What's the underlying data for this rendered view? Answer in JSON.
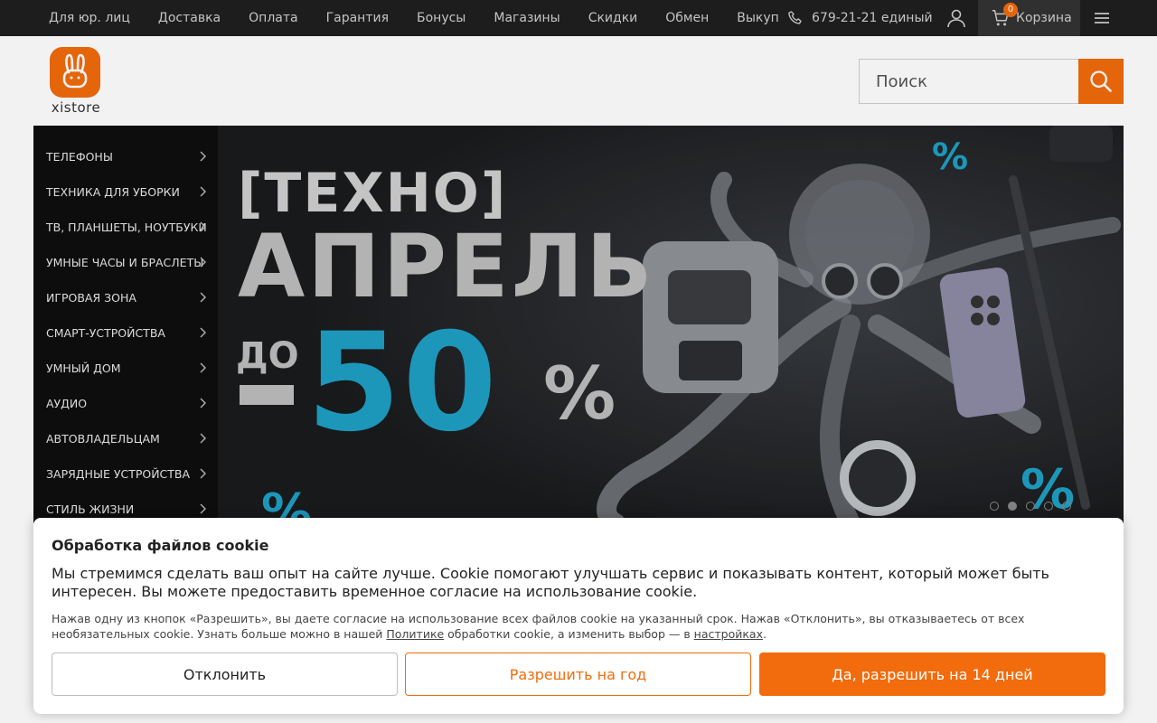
{
  "topbar": {
    "nav": [
      "Для юр. лиц",
      "Доставка",
      "Оплата",
      "Гарантия",
      "Бонусы",
      "Магазины",
      "Скидки",
      "Обмен",
      "Выкуп"
    ],
    "phone": "679-21-21 единый",
    "cart_label": "Корзина",
    "cart_count": "0"
  },
  "header": {
    "logo_text": "xistore",
    "search_placeholder": "Поиск"
  },
  "categories": [
    "ТЕЛЕФОНЫ",
    "ТЕХНИКА ДЛЯ УБОРКИ",
    "ТВ, ПЛАНШЕТЫ, НОУТБУКИ",
    "УМНЫЕ ЧАСЫ И БРАСЛЕТЫ",
    "ИГРОВАЯ ЗОНА",
    "СМАРТ-УСТРОЙСТВА",
    "УМНЫЙ ДОМ",
    "АУДИО",
    "АВТОВЛАДЕЛЬЦАМ",
    "ЗАРЯДНЫЕ УСТРОЙСТВА",
    "СТИЛЬ ЖИЗНИ"
  ],
  "banner": {
    "title": "[ТЕХНО]",
    "word": "АПРЕЛЬ",
    "do": "ДО",
    "number": "50",
    "percent": "%",
    "slides": 5,
    "active_slide": 2
  },
  "cookie": {
    "title": "Обработка файлов cookie",
    "text": "Мы стремимся сделать ваш опыт на сайте лучше. Cookie помогают улучшать сервис и показывать контент, который может быть интересен. Вы можете предоставить временное согласие на использование cookie.",
    "note_part1": "Нажав одну из кнопок «Разрешить», вы даете согласие на использование всех файлов cookie на указанный срок. Нажав «Отклонить», вы отказываетесь от всех необязательных cookie. Узнать больше можно в нашей ",
    "policy_link": "Политике",
    "note_part2": " обработки cookie, а изменить выбор — в ",
    "settings_link": "настройках",
    "note_part3": ".",
    "decline": "Отклонить",
    "allow_year": "Разрешить на год",
    "allow_days": "Да, разрешить на 14 дней"
  },
  "colors": {
    "accent": "#f26b0c",
    "banner_blue": "#1ea0c4",
    "topbar": "#1f1f1f"
  }
}
